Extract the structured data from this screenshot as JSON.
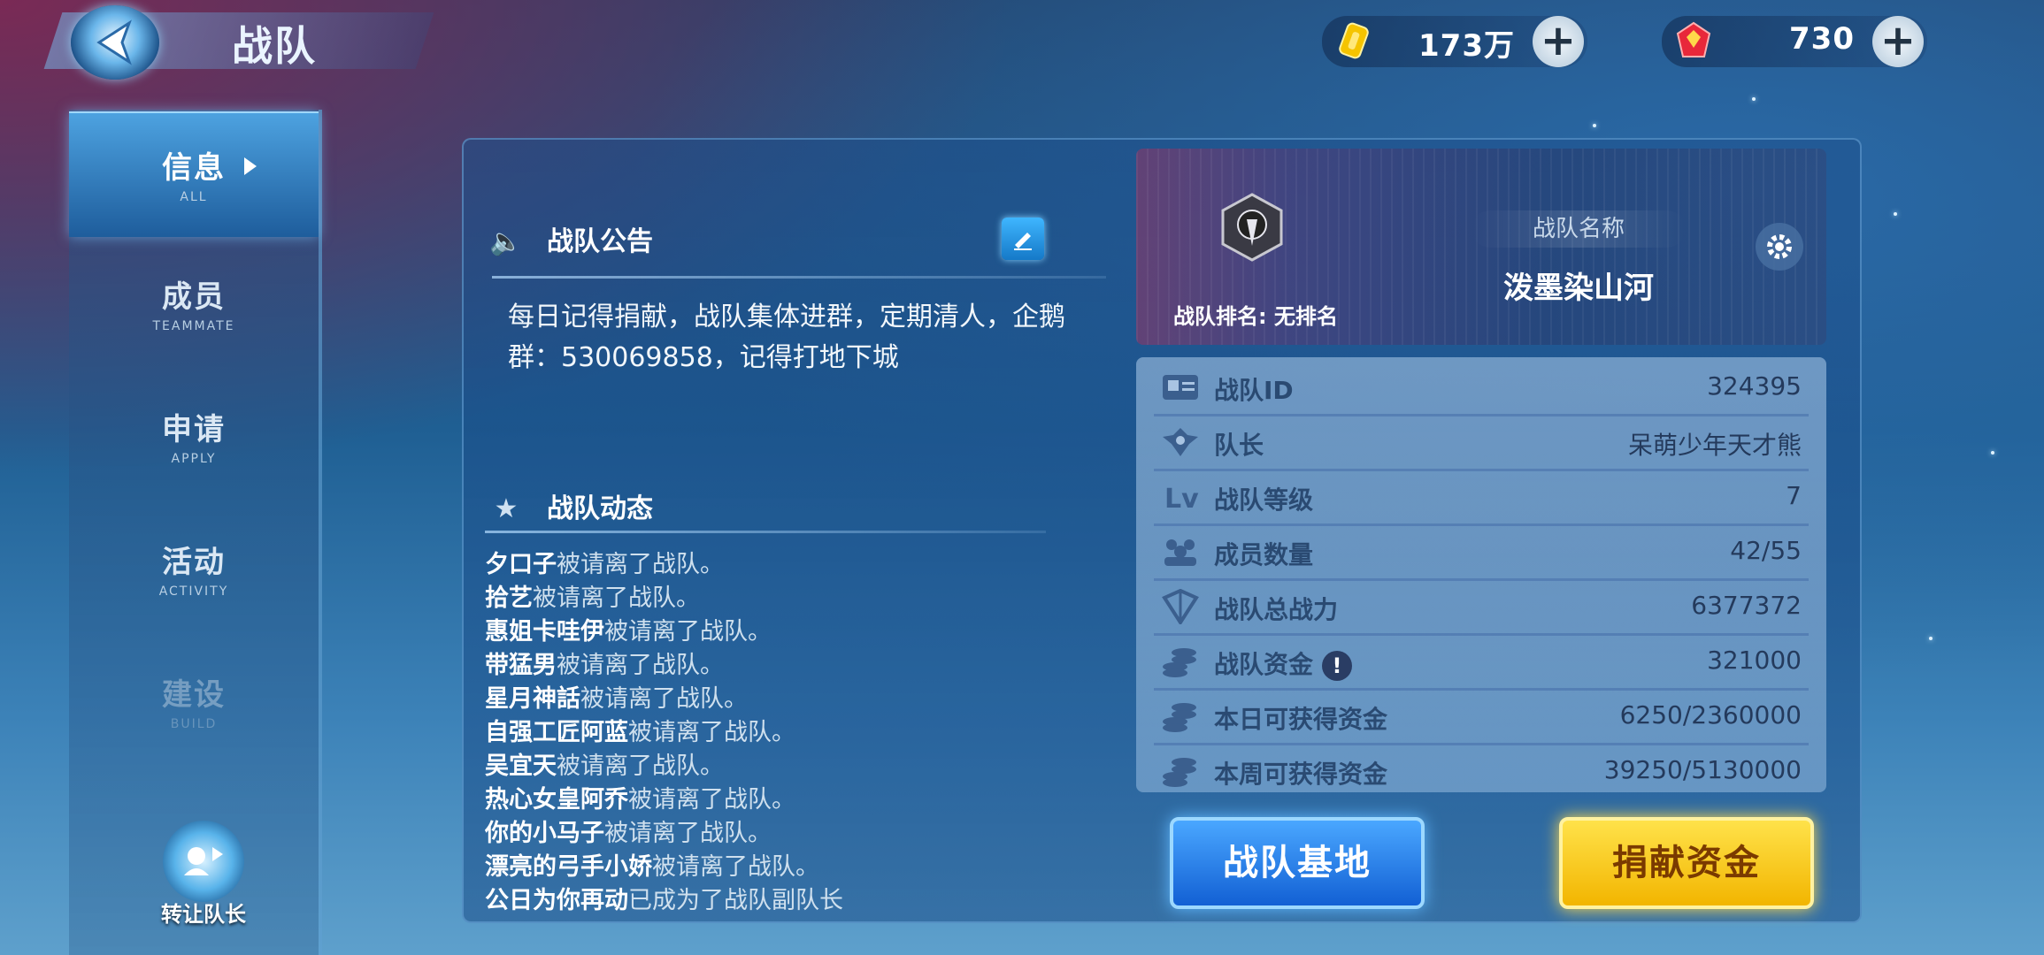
{
  "header": {
    "title": "战队"
  },
  "resources": {
    "gold": {
      "value": "173万",
      "icon": "gold-coin-icon"
    },
    "gem": {
      "value": "730",
      "icon": "red-gem-icon"
    }
  },
  "sidebar": {
    "tabs": [
      {
        "cn": "信息",
        "en": "ALL"
      },
      {
        "cn": "成员",
        "en": "TEAMMATE"
      },
      {
        "cn": "申请",
        "en": "APPLY"
      },
      {
        "cn": "活动",
        "en": "ACTIVITY"
      },
      {
        "cn": "建设",
        "en": "BUILD"
      }
    ],
    "transfer_label": "转让队长"
  },
  "announcement": {
    "heading": "战队公告",
    "text": "每日记得捐献，战队集体进群，定期清人，企鹅群：530069858，记得打地下城"
  },
  "activity": {
    "heading": "战队动态",
    "entries": [
      {
        "name": "夕口子",
        "action": "被请离了战队。"
      },
      {
        "name": "拾艺",
        "action": "被请离了战队。"
      },
      {
        "name": "惠姐卡哇伊",
        "action": "被请离了战队。"
      },
      {
        "name": "带猛男",
        "action": "被请离了战队。"
      },
      {
        "name": "星月神話",
        "action": "被请离了战队。"
      },
      {
        "name": "自强工匠阿蓝",
        "action": "被请离了战队。"
      },
      {
        "name": "吴宜天",
        "action": "被请离了战队。"
      },
      {
        "name": "热心女皇阿乔",
        "action": "被请离了战队。"
      },
      {
        "name": "你的小马子",
        "action": "被请离了战队。"
      },
      {
        "name": "漂亮的弓手小娇",
        "action": "被请离了战队。"
      },
      {
        "name": "公日为你再动",
        "action": "已成为了战队副队长"
      }
    ]
  },
  "team_card": {
    "rank_text": "战队排名: 无排名",
    "name_label": "战队名称",
    "name": "泼墨染山河"
  },
  "stats": [
    {
      "icon": "id-card-icon",
      "label": "战队ID",
      "value": "324395"
    },
    {
      "icon": "captain-badge-icon",
      "label": "队长",
      "value": "呆萌少年天才熊"
    },
    {
      "icon": "level-icon",
      "label": "战队等级",
      "value": "7"
    },
    {
      "icon": "members-icon",
      "label": "成员数量",
      "value": "42/55"
    },
    {
      "icon": "power-icon",
      "label": "战队总战力",
      "value": "6377372"
    },
    {
      "icon": "coins-icon",
      "label": "战队资金",
      "value": "321000"
    },
    {
      "icon": "coins-icon",
      "label": "本日可获得资金",
      "value": "6250/2360000"
    },
    {
      "icon": "coins-icon",
      "label": "本周可获得资金",
      "value": "39250/5130000"
    }
  ],
  "buttons": {
    "base": "战队基地",
    "donate": "捐献资金"
  }
}
